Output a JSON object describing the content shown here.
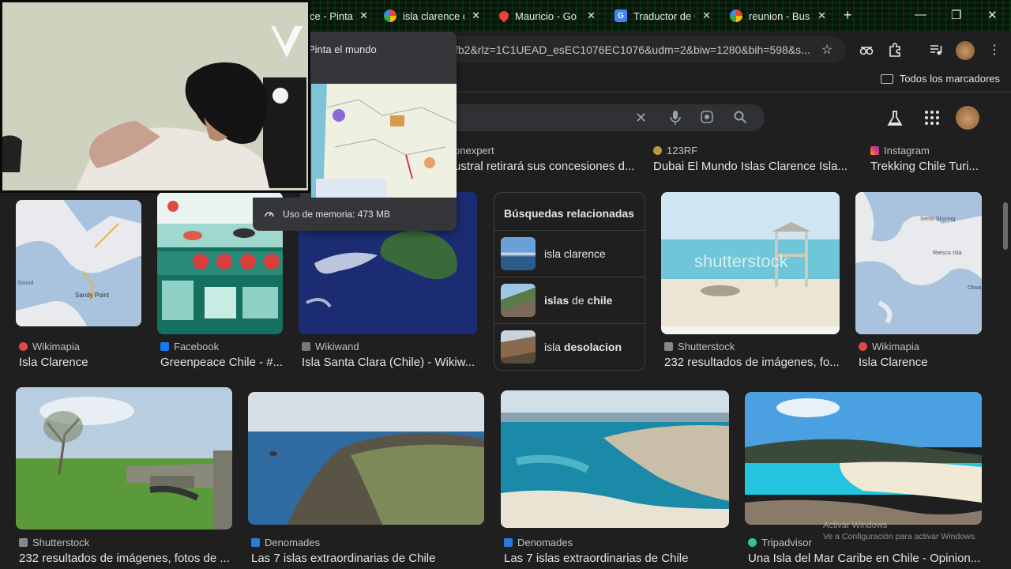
{
  "tabs": [
    {
      "title": "ce - Pinta",
      "favicon": "pinterest-icon"
    },
    {
      "title": "isla clarence c",
      "favicon": "google-icon"
    },
    {
      "title": "Mauricio - Go",
      "favicon": "maps-pin-icon"
    },
    {
      "title": "Traductor de G",
      "favicon": "translate-icon"
    },
    {
      "title": "reunion - Bus",
      "favicon": "google-icon"
    }
  ],
  "omnibox": {
    "url": "fb2&rlz=1C1UEAD_esEC1076EC1076&udm=2&biw=1280&bih=598&s..."
  },
  "bookmarks": {
    "all_label": "Todos los marcadores"
  },
  "tab_preview": {
    "title": "Pinta el mundo",
    "memory": "Uso de memoria: 473 MB"
  },
  "top_row": [
    {
      "source": "onexpert",
      "title": "ustral retirará sus concesiones d..."
    },
    {
      "source": "123RF",
      "title": "Dubai El Mundo Islas Clarence Isla..."
    },
    {
      "source": "Instagram",
      "title": "Trekking Chile Turi..."
    }
  ],
  "row2": [
    {
      "source": "Wikimapia",
      "title": "Isla Clarence"
    },
    {
      "source": "Facebook",
      "title": "Greenpeace Chile - #..."
    },
    {
      "source": "Wikiwand",
      "title": "Isla Santa Clara (Chile) - Wikiw..."
    },
    {
      "source": "Shutterstock",
      "title": "232 resultados de imágenes, fo..."
    },
    {
      "source": "Wikimapia",
      "title": "Isla Clarence"
    }
  ],
  "related": {
    "heading": "Búsquedas relacionadas",
    "items": [
      {
        "pre": "isla clarence",
        "bold": ""
      },
      {
        "pre": "",
        "bold": "islas",
        "post": " de ",
        "bold2": "chile"
      },
      {
        "pre": "isla ",
        "bold": "desolacion"
      }
    ]
  },
  "row3": [
    {
      "source": "Shutterstock",
      "title": "232 resultados de imágenes, fotos de ..."
    },
    {
      "source": "Denomades",
      "title": "Las 7 islas extraordinarias de Chile"
    },
    {
      "source": "Denomades",
      "title": "Las 7 islas extraordinarias de Chile"
    },
    {
      "source": "Tripadvisor",
      "title": "Una Isla del Mar Caribe en Chile - Opinion..."
    }
  ],
  "map_labels": {
    "sandy_point": "Sandy Point",
    "sound": "Sound",
    "riesco": "Riesco Isla",
    "otwa": "Otwa",
    "seno": "Seno Skyring"
  },
  "watermark": "shutterstock",
  "activate_windows": {
    "line1": "Activar Windows",
    "line2": "Ve a Configuración para activar Windows."
  },
  "colors": {
    "page_bg": "#1f1f1f",
    "accent": "#8ab4f8"
  }
}
